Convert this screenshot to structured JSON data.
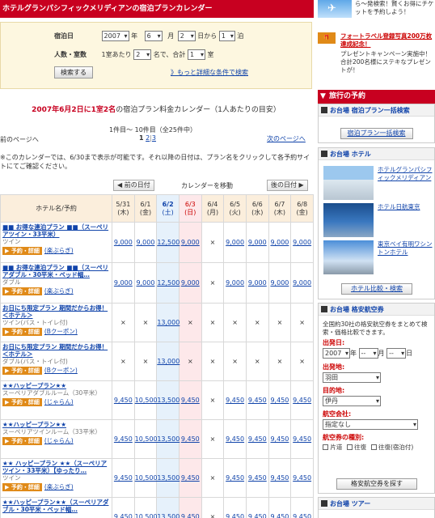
{
  "title": "ホテルグランパシフィックメリディアンの宿泊プランカレンダー",
  "search": {
    "checkin_label": "宿泊日",
    "year": "2007",
    "year_unit": "年",
    "month": "6",
    "month_unit": "月",
    "day": "2",
    "day_unit": "日から",
    "nights": "1",
    "nights_unit": "泊",
    "people_label": "人数・室数",
    "per_room": "1室あたり",
    "people": "2",
    "people_unit": "名で、合計",
    "rooms": "1",
    "rooms_unit": "室",
    "search_button": "検索する",
    "detail_link": "》もっと詳細な条件で検索"
  },
  "headline": {
    "prefix": "2007年6月2日に1室2名",
    "suffix": "の宿泊プラン料金カレンダー（1人あたりの目安）"
  },
  "pager": {
    "prev": "前のページへ",
    "range": "1件目～ 10件目（全25件中）",
    "pages": [
      "1",
      "2",
      "3"
    ],
    "next": "次のページへ"
  },
  "note": "※このカレンダーでは、6/30まで表示が可能です。それ以降の日付は、プラン名をクリックして各予約サイトにてご確認ください。",
  "calendar_nav": {
    "prev": "◀ 前の日付",
    "center": "カレンダーを移動",
    "next": "後の日付 ▶"
  },
  "table": {
    "hotel_header": "ホテル名/予約",
    "dates": [
      {
        "d": "5/31",
        "w": "(木)",
        "kind": "normal"
      },
      {
        "d": "6/1",
        "w": "(金)",
        "kind": "normal"
      },
      {
        "d": "6/2",
        "w": "(土)",
        "kind": "today"
      },
      {
        "d": "6/3",
        "w": "(日)",
        "kind": "sun"
      },
      {
        "d": "6/4",
        "w": "(月)",
        "kind": "normal"
      },
      {
        "d": "6/5",
        "w": "(火)",
        "kind": "normal"
      },
      {
        "d": "6/6",
        "w": "(水)",
        "kind": "normal"
      },
      {
        "d": "6/7",
        "w": "(木)",
        "kind": "normal"
      },
      {
        "d": "6/8",
        "w": "(金)",
        "kind": "normal"
      }
    ],
    "reserve_label": "▶ 予約・詳細",
    "rows": [
      {
        "name": "■■ お得な連泊プラン ■■（スーペリアツイン・33平米）",
        "sub": "ツイン",
        "site": "(楽ぶらぎ)",
        "prices": [
          "9,000",
          "9,000",
          "12,500",
          "9,000",
          "×",
          "9,000",
          "9,000",
          "9,000",
          "9,000"
        ]
      },
      {
        "name": "■■ お得な連泊プラン ■■（スーペリアダブル・30平米・ベッド幅…",
        "sub": "ダブル",
        "site": "(楽ぶらぎ)",
        "prices": [
          "9,000",
          "9,000",
          "12,500",
          "9,000",
          "×",
          "9,000",
          "9,000",
          "9,000",
          "9,000"
        ]
      },
      {
        "name": "お日にち限定プラン 期間だからお得！＜ホテル＞",
        "sub": "ツイン(バス・トイレ付)",
        "site": "(Bクーポン)",
        "prices": [
          "×",
          "×",
          "13,000",
          "×",
          "×",
          "×",
          "×",
          "×",
          "×"
        ]
      },
      {
        "name": "お日にち限定プラン 期間だからお得！＜ホテル＞",
        "sub": "ダブル(バス・トイレ付)",
        "site": "(Bクーポン)",
        "prices": [
          "×",
          "×",
          "13,000",
          "×",
          "×",
          "×",
          "×",
          "×",
          "×"
        ]
      },
      {
        "name": "★★ハッピープラン★★",
        "sub": "スーペリアダブルルーム（30平米）",
        "site": "(じゃらん)",
        "prices": [
          "9,450",
          "10,500",
          "13,500",
          "9,450",
          "×",
          "9,450",
          "9,450",
          "9,450",
          "9,450"
        ]
      },
      {
        "name": "★★ハッピープラン★★",
        "sub": "スーペリアツインルーム（33平米）",
        "site": "(じゃらん)",
        "prices": [
          "9,450",
          "10,500",
          "13,500",
          "9,450",
          "×",
          "9,450",
          "9,450",
          "9,450",
          "9,450"
        ]
      },
      {
        "name": "★★ ハッピープラン ★★（スーペリアツイン・33平米）【ゆったり…",
        "sub": "ツイン",
        "site": "(楽ぶらぎ)",
        "prices": [
          "9,450",
          "10,500",
          "13,500",
          "9,450",
          "×",
          "9,450",
          "9,450",
          "9,450",
          "9,450"
        ]
      },
      {
        "name": "★★ハッピープラン★★（スーペリアダブル・30平米・ベッド幅…",
        "sub": "",
        "site": "",
        "prices": [
          "9,450",
          "10,500",
          "13,500",
          "9,450",
          "×",
          "9,450",
          "9,450",
          "9,450",
          "9,450"
        ]
      }
    ]
  },
  "side": {
    "promo1": "ら～発検索！賢くお得にチケットを予約しよう！",
    "promo2_title": "フォートラベル登録写真200万枚達成記念！",
    "promo2_text": "プレゼントキャンペーン実施中！合計200名様にステキなプレゼントが！",
    "travel_title": "旅行の予約",
    "bulk_head": "お台場 宿泊プラン一括検索",
    "bulk_button": "宿泊プラン一括検索",
    "hotel_head": "お台場 ホテル",
    "hotels": [
      "ホテルグランパシフィックメリディアン",
      "ホテル日航東京",
      "東京ベイ有明ワシントンホテル"
    ],
    "compare_button": "ホテル比較・検索",
    "air_head": "お台場 格安航空券",
    "air_note": "全国約30社の格安航空券をまとめて検索・価格比較できます。",
    "dep_date_label": "出発日:",
    "dep_year": "2007",
    "dep_month": "--",
    "dep_day": "--",
    "year_unit": "年",
    "month_unit": "月",
    "day_unit": "日",
    "from_label": "出発地:",
    "from_value": "羽田",
    "to_label": "目的地:",
    "to_value": "伊丹",
    "airline_label": "航空会社:",
    "airline_value": "指定なし",
    "type_label": "航空券の種別:",
    "type_oneway": "片道",
    "type_round": "往復",
    "type_stay": "往復(宿泊付)",
    "air_button": "格安航空券を探す",
    "tour_head": "お台場 ツアー"
  }
}
